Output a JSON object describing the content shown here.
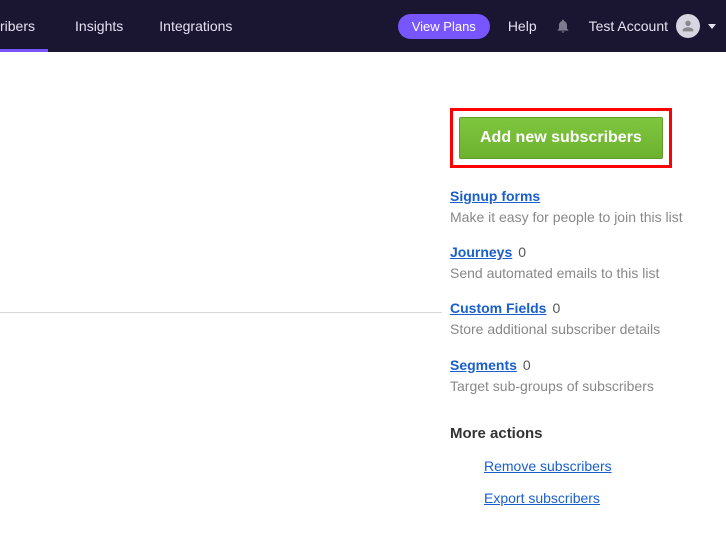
{
  "topnav": {
    "tabs": {
      "subscribers": "ribers",
      "insights": "Insights",
      "integrations": "Integrations"
    },
    "view_plans": "View Plans",
    "help": "Help",
    "account_name": "Test Account"
  },
  "sidebar": {
    "add_button": "Add new subscribers",
    "signup": {
      "label": "Signup forms",
      "desc": "Make it easy for people to join this list"
    },
    "journeys": {
      "label": "Journeys",
      "count": "0",
      "desc": "Send automated emails to this list"
    },
    "custom_fields": {
      "label": "Custom Fields",
      "count": "0",
      "desc": "Store additional subscriber details"
    },
    "segments": {
      "label": "Segments",
      "count": "0",
      "desc": "Target sub-groups of subscribers"
    },
    "more_actions_heading": "More actions",
    "remove_link": "Remove subscribers",
    "export_link": "Export subscribers"
  }
}
